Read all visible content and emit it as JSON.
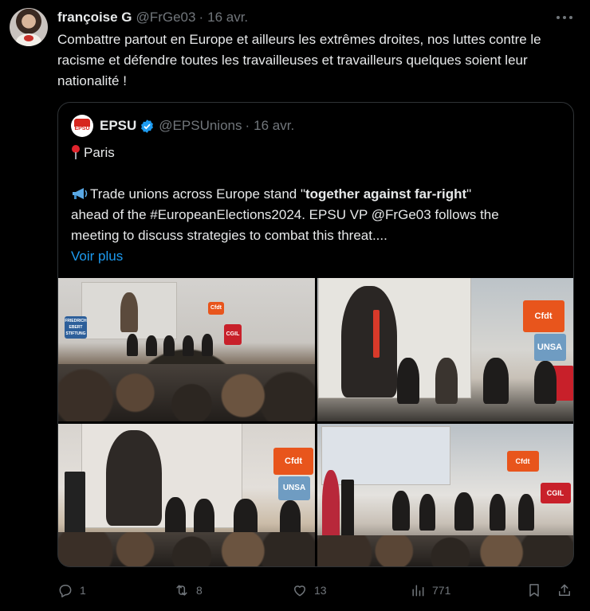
{
  "tweet": {
    "display_name": "françoise G",
    "handle": "@FrGe03",
    "dot": "·",
    "date": "16 avr.",
    "text": "Combattre partout en Europe et ailleurs les extrêmes droites, nos luttes contre le racisme et défendre toutes les travailleuses et travailleurs quelques soient leur nationalité !"
  },
  "quote": {
    "avatar_text": "EPSU",
    "display_name": "EPSU",
    "handle": "@EPSUnions",
    "dot": "·",
    "date": "16 avr.",
    "line1": "Paris",
    "line3_pre": "Trade unions across Europe stand \"",
    "line3_bold": "together against far-right",
    "line3_post": "\"",
    "line4": "ahead of the #EuropeanElections2024. EPSU VP @FrGe03 follows the",
    "line5": "meeting to discuss strategies to combat this threat....",
    "voir_plus": "Voir plus"
  },
  "photos": {
    "sign_cfdt": "Cfdt",
    "sign_cgil": "CGIL",
    "sign_unsa": "UNSA",
    "sign_fes": "FRIEDRICH EBERT STIFTUNG"
  },
  "actions": {
    "replies": "1",
    "reposts": "8",
    "likes": "13",
    "views": "771"
  },
  "colors": {
    "background": "#000000",
    "text": "#e7e9ea",
    "muted": "#71767b",
    "link": "#1d9bf0",
    "border": "#2f3336"
  }
}
